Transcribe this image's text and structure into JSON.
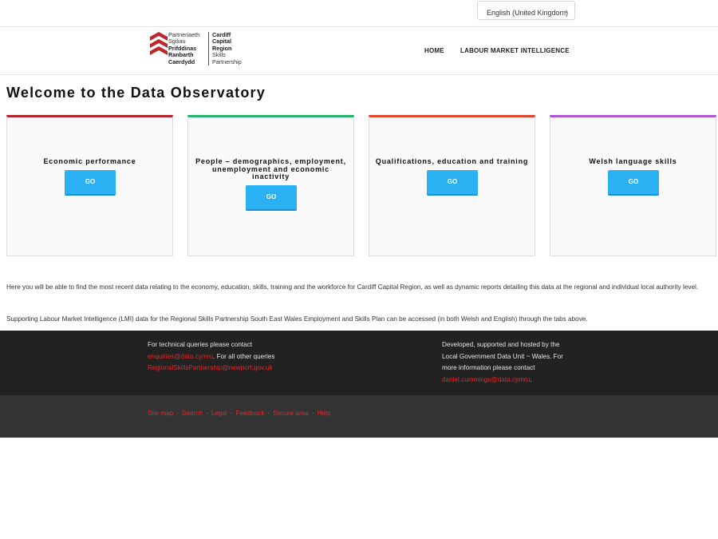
{
  "language": {
    "selected": "English (United Kingdom)"
  },
  "header": {
    "logo": {
      "welsh_lines": [
        "Partneriaeth",
        "Sgiliau",
        "Prifddinas",
        "Ranbarth",
        "Caerdydd"
      ],
      "english_lines": [
        "Cardiff",
        "Capital",
        "Region",
        "Skills",
        "Partnership"
      ],
      "brand_color": "#c0272d"
    },
    "nav": {
      "home": "HOME",
      "lmi": "LABOUR MARKET INTELLIGENCE"
    }
  },
  "main": {
    "title": "Welcome to the Data Observatory",
    "cards": [
      {
        "title": "Economic performance",
        "button": "GO",
        "accent": "#b3262b"
      },
      {
        "title": "People – demographics, employment, unemployment and economic inactivity",
        "button": "GO",
        "accent": "#23b36c"
      },
      {
        "title": "Qualifications, education and training",
        "button": "GO",
        "accent": "#e2472f"
      },
      {
        "title": "Welsh language skills",
        "button": "GO",
        "accent": "#b255d8"
      }
    ],
    "para1": "Here you will be able to find the most recent data relating to the economy, education, skills, training and the workforce for Cardiff Capital Region, as well as dynamic reports detailing this data at the regional and individual local authority level.",
    "para2": "Supporting Labour Market Intelligence (LMI) data for the Regional Skills Partnership South East Wales Employment and Skills Plan can be accessed (in both Welsh and English) through the tabs above."
  },
  "footer": {
    "left": {
      "line1": "For technical queries please contact",
      "email1": "enquiries@data.cymru",
      "text2": ". For all other queries",
      "email2": "RegionalSkillsPartnership@newport.gov.uk"
    },
    "right": {
      "line1": "Developed, supported and hosted by the",
      "line2": "Local Government Data Unit ~ Wales. For",
      "line3": "more information please contact",
      "email": "daniel.cummings@data.cymru",
      "end": "."
    },
    "links": [
      "Site map",
      "Search",
      "Legal",
      "Feedback",
      "Secure area",
      "Help"
    ],
    "separator": "·"
  }
}
